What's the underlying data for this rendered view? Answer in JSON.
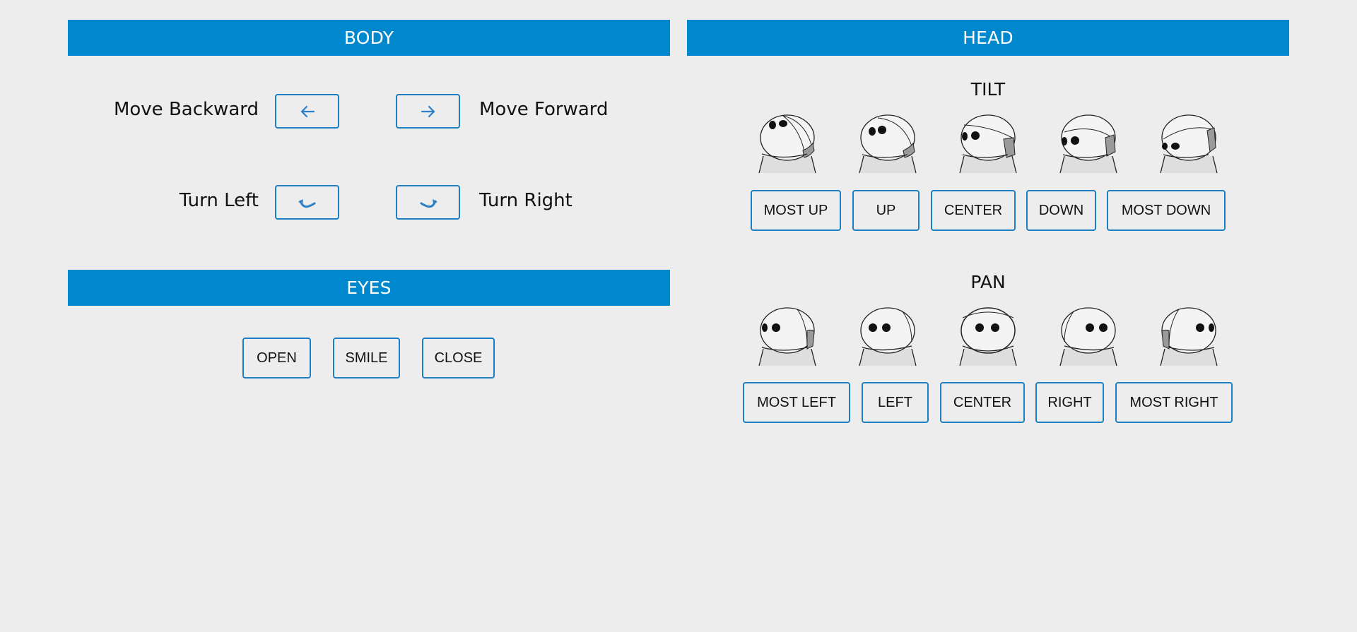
{
  "body": {
    "title": "BODY",
    "move_backward_label": "Move Backward",
    "move_forward_label": "Move Forward",
    "turn_left_label": "Turn Left",
    "turn_right_label": "Turn Right",
    "icons": [
      "arrow-left-icon",
      "arrow-right-icon",
      "turn-left-icon",
      "turn-right-icon"
    ]
  },
  "eyes": {
    "title": "EYES",
    "buttons": [
      "OPEN",
      "SMILE",
      "CLOSE"
    ]
  },
  "head": {
    "title": "HEAD",
    "tilt": {
      "title": "TILT",
      "buttons": [
        "MOST UP",
        "UP",
        "CENTER",
        "DOWN",
        "MOST DOWN"
      ]
    },
    "pan": {
      "title": "PAN",
      "buttons": [
        "MOST LEFT",
        "LEFT",
        "CENTER",
        "RIGHT",
        "MOST RIGHT"
      ]
    }
  },
  "colors": {
    "header_bg": "#0088ce",
    "button_border": "#1b7fc2",
    "page_bg": "#ededed"
  }
}
